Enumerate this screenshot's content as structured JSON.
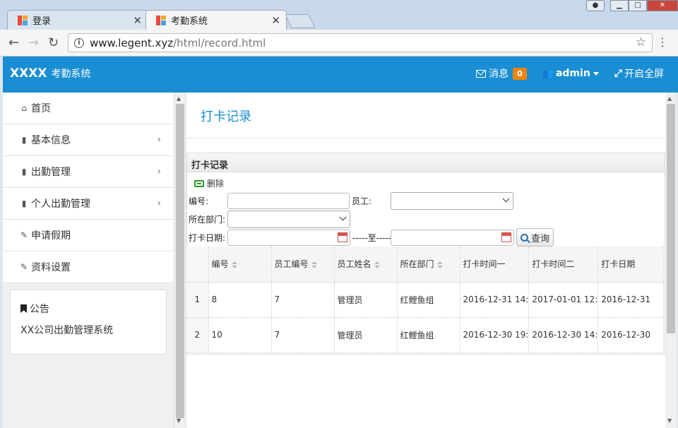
{
  "browser": {
    "tabs": [
      {
        "title": "登录",
        "active": false
      },
      {
        "title": "考勤系统",
        "active": true
      }
    ],
    "url_host": "www.legent.xyz",
    "url_path": "/html/record.html"
  },
  "header": {
    "brand_bold": "XXXX",
    "brand_text": "考勤系统",
    "messages_label": "消息",
    "messages_count": "0",
    "user_label": "admin",
    "fullscreen_label": "开启全屏"
  },
  "sidebar": {
    "items": [
      {
        "label": "首页",
        "icon": "home-icon",
        "has_children": false
      },
      {
        "label": "基本信息",
        "icon": "file-icon",
        "has_children": true
      },
      {
        "label": "出勤管理",
        "icon": "file-icon",
        "has_children": true
      },
      {
        "label": "个人出勤管理",
        "icon": "file-icon",
        "has_children": true
      },
      {
        "label": "申请假期",
        "icon": "edit-icon",
        "has_children": false
      },
      {
        "label": "资料设置",
        "icon": "edit-icon",
        "has_children": false
      }
    ],
    "notice_title": "公告",
    "notice_text": "XX公司出勤管理系统"
  },
  "main": {
    "page_title": "打卡记录",
    "panel_title": "打卡记录",
    "delete_label": "删除",
    "filters": {
      "id_label": "编号:",
      "employee_label": "员工:",
      "department_label": "所在部门:",
      "date_label": "打卡日期:",
      "range_sep": "-----至-----",
      "query_label": "查询"
    },
    "table": {
      "columns": [
        "编号",
        "员工编号",
        "员工姓名",
        "所在部门",
        "打卡时间一",
        "打卡时间二",
        "打卡日期"
      ],
      "rows": [
        {
          "rn": "1",
          "cells": [
            "8",
            "7",
            "管理员",
            "红鲤鱼组",
            "2016-12-31 14:",
            "2017-01-01 12:",
            "2016-12-31"
          ]
        },
        {
          "rn": "2",
          "cells": [
            "10",
            "7",
            "管理员",
            "红鲤鱼组",
            "2016-12-30 19:",
            "2016-12-30 14:",
            "2016-12-30"
          ]
        }
      ]
    }
  },
  "colors": {
    "accent": "#1a8ed3",
    "badge": "#f0830a"
  }
}
